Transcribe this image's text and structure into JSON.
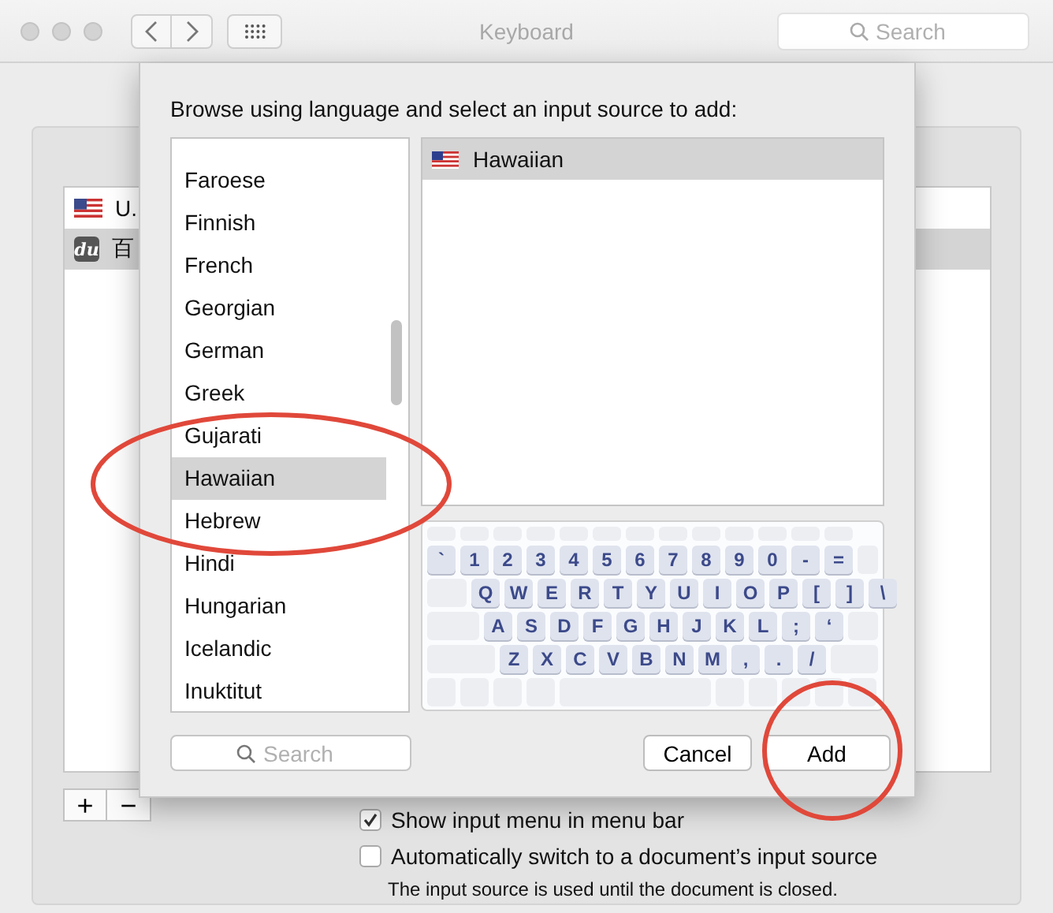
{
  "window": {
    "title": "Keyboard",
    "search": {
      "placeholder": "Search"
    }
  },
  "background": {
    "input_sources": [
      {
        "label": "U.",
        "kind": "flag",
        "selected": false
      },
      {
        "label": "百",
        "kind": "app",
        "icon_text": "du",
        "selected": true
      }
    ],
    "add_remove_buttons": [
      "+",
      "−"
    ],
    "options": [
      {
        "label": "Show input menu in menu bar",
        "checked": true
      },
      {
        "label": "Automatically switch to a document’s input source",
        "checked": false
      }
    ],
    "note": "The input source is used until the document is closed."
  },
  "sheet": {
    "heading": "Browse using language and select an input source to add:",
    "languages": [
      {
        "label": "Faroese",
        "selected": false
      },
      {
        "label": "Finnish",
        "selected": false
      },
      {
        "label": "French",
        "selected": false
      },
      {
        "label": "Georgian",
        "selected": false
      },
      {
        "label": "German",
        "selected": false
      },
      {
        "label": "Greek",
        "selected": false
      },
      {
        "label": "Gujarati",
        "selected": false
      },
      {
        "label": "Hawaiian",
        "selected": true
      },
      {
        "label": "Hebrew",
        "selected": false
      },
      {
        "label": "Hindi",
        "selected": false
      },
      {
        "label": "Hungarian",
        "selected": false
      },
      {
        "label": "Icelandic",
        "selected": false
      },
      {
        "label": "Inuktitut",
        "selected": false
      }
    ],
    "sources": [
      {
        "label": "Hawaiian",
        "selected": true
      }
    ],
    "keyboard_rows": [
      [
        "`",
        "1",
        "2",
        "3",
        "4",
        "5",
        "6",
        "7",
        "8",
        "9",
        "0",
        "-",
        "="
      ],
      [
        "Q",
        "W",
        "E",
        "R",
        "T",
        "Y",
        "U",
        "I",
        "O",
        "P",
        "[",
        "]",
        "\\"
      ],
      [
        "A",
        "S",
        "D",
        "F",
        "G",
        "H",
        "J",
        "K",
        "L",
        ";",
        "‘"
      ],
      [
        "Z",
        "X",
        "C",
        "V",
        "B",
        "N",
        "M",
        ",",
        ".",
        "/"
      ]
    ],
    "search": {
      "placeholder": "Search"
    },
    "buttons": [
      "Cancel",
      "Add"
    ]
  }
}
